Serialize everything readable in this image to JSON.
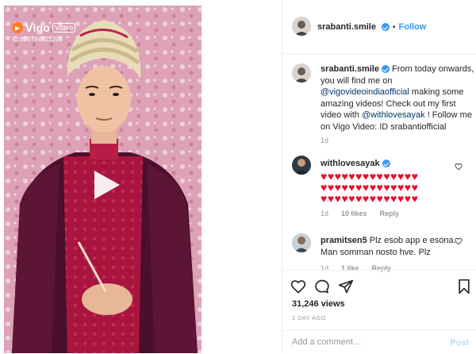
{
  "media": {
    "watermark_brand": "Vigo",
    "watermark_badge": "Video",
    "watermark_id": "ID:826784321201"
  },
  "header": {
    "username": "srabanti.smile",
    "separator": "•",
    "follow_label": "Follow"
  },
  "caption": {
    "username": "srabanti.smile",
    "text_1": " From today onwards, you will find me on ",
    "mention_1": "@vigovideoindiaofficial",
    "text_2": " making some amazing videos! Check out my first video with ",
    "mention_2": "@withlovesayak",
    "text_3": " ! Follow me on Vigo Video: ID srabantiofficial",
    "age": "1d"
  },
  "comments": [
    {
      "username": "withlovesayak",
      "verified": true,
      "hearts_line_1": "♥♥♥♥♥♥♥♥♥♥♥♥♥♥",
      "hearts_line_2": "♥♥♥♥♥♥♥♥♥♥♥♥♥♥",
      "hearts_line_3": "♥♥♥♥♥♥♥♥♥♥♥♥♥♥",
      "age": "1d",
      "likes": "10 likes",
      "reply": "Reply"
    },
    {
      "username": "pramitsen5",
      "text": " Plz esob app e esona. Man somman nosto hve. Plz",
      "age": "1d",
      "likes": "1 like",
      "reply": "Reply"
    }
  ],
  "actions": {
    "views": "31,246 views",
    "date": "1 DAY AGO",
    "icons": [
      "heart-icon",
      "comment-icon",
      "share-icon",
      "bookmark-icon"
    ]
  },
  "add_comment": {
    "placeholder": "Add a comment…",
    "post_label": "Post"
  },
  "colors": {
    "link": "#003569",
    "accent": "#3897f0",
    "heart": "#e8102d",
    "muted": "#999999"
  }
}
